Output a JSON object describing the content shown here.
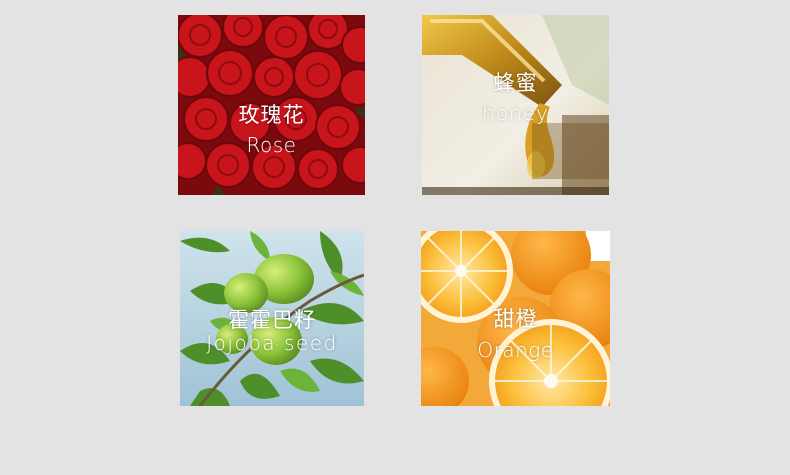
{
  "ingredients": [
    {
      "name_cn": "玫瑰花",
      "name_en": "Rose"
    },
    {
      "name_cn": "蜂蜜",
      "name_en": "honey"
    },
    {
      "name_cn": "霍霍巴籽",
      "name_en": "Jojoba seed"
    },
    {
      "name_cn": "甜橙",
      "name_en": "Orange"
    }
  ],
  "colors": {
    "background": "#e3e3e3",
    "caption_text": "#ffffff",
    "rose_red": "#c8151c",
    "honey_amber": "#c08a1a",
    "jojoba_green": "#7fb83a",
    "orange": "#f5a623"
  }
}
